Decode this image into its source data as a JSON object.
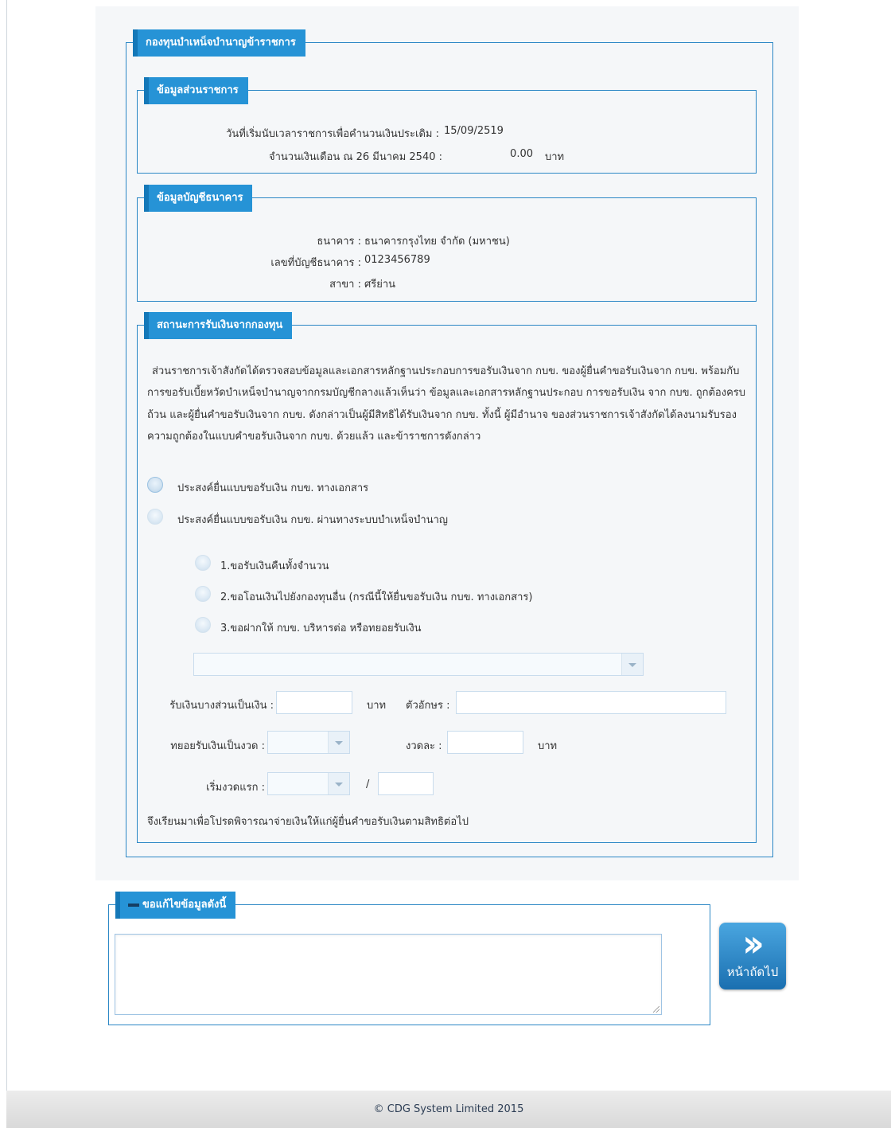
{
  "fund_section": {
    "title": "กองทุนบำเหน็จบำนาญข้าราชการ"
  },
  "agency_section": {
    "title": "ข้อมูลส่วนราชการ",
    "start_date_label": "วันที่เริ่มนับเวลาราชการเพื่อคำนวนเงินประเดิม :",
    "start_date_value": "15/09/2519",
    "salary_label": "จำนวนเงินเดือน ณ 26 มีนาคม 2540 :",
    "salary_value": "0.00",
    "salary_unit": "บาท"
  },
  "bank_section": {
    "title": "ข้อมูลบัญชีธนาคาร",
    "bank_label": "ธนาคาร :",
    "bank_value": "ธนาคารกรุงไทย จำกัด (มหาชน)",
    "account_label": "เลขที่บัญชีธนาคาร :",
    "account_value": "0123456789",
    "branch_label": "สาขา :",
    "branch_value": "ศรีย่าน"
  },
  "status_section": {
    "title": "สถานะการรับเงินจากกองทุน",
    "paragraph": "ส่วนราชการเจ้าสังกัดได้ตรวจสอบข้อมูลและเอกสารหลักฐานประกอบการขอรับเงินจาก กบข. ของผู้ยื่นคำขอรับเงินจาก กบข. พร้อมกับการขอรับเบี้ยหวัดบำเหน็จบำนาญจากกรมบัญชีกลางแล้วเห็นว่า ข้อมูลและเอกสารหลักฐานประกอบ การขอรับเงิน จาก กบข. ถูกต้องครบถ้วน และผู้ยื่นคำขอรับเงินจาก กบข. ดังกล่าวเป็นผู้มีสิทธิได้รับเงินจาก กบข. ทั้งนี้ ผู้มีอำนาจ ของส่วนราชการเจ้าสังกัดได้ลงนามรับรองความถูกต้องในแบบคำขอรับเงินจาก กบข. ด้วยแล้ว และข้าราชการดังกล่าว",
    "option_document": "ประสงค์ยื่นแบบขอรับเงิน กบข. ทางเอกสาร",
    "option_system": "ประสงค์ยื่นแบบขอรับเงิน กบข. ผ่านทางระบบบำเหน็จบำนาญ",
    "sub_option_1": "1.ขอรับเงินคืนทั้งจำนวน",
    "sub_option_2": "2.ขอโอนเงินไปยังกองทุนอื่น (กรณีนี้ให้ยื่นขอรับเงิน กบข. ทางเอกสาร)",
    "sub_option_3": "3.ขอฝากให้ กบข. บริหารต่อ หรือทยอยรับเงิน",
    "partial_label": "รับเงินบางส่วนเป็นเงิน :",
    "partial_unit": "บาท",
    "letters_label": "ตัวอักษร :",
    "installments_label": "ทยอยรับเงินเป็นงวด :",
    "per_installment_label": "งวดละ :",
    "per_installment_unit": "บาท",
    "first_installment_label": "เริ่มงวดแรก :",
    "slash": "/",
    "closing": "จึงเรียนมาเพื่อโปรดพิจารณาจ่ายเงินให้แก่ผู้ยื่นคำขอรับเงินตามสิทธิต่อไป"
  },
  "correction_section": {
    "title": "ขอแก้ไขข้อมูลดังนี้"
  },
  "next_button": {
    "label": "หน้าถัดไป",
    "icon": "double-chevron-right-icon"
  },
  "footer": {
    "copyright": "© CDG System Limited 2015"
  },
  "colors": {
    "legend_bg": "#2693d6",
    "border": "#2b87c5",
    "footer_text": "#2d3e55"
  }
}
